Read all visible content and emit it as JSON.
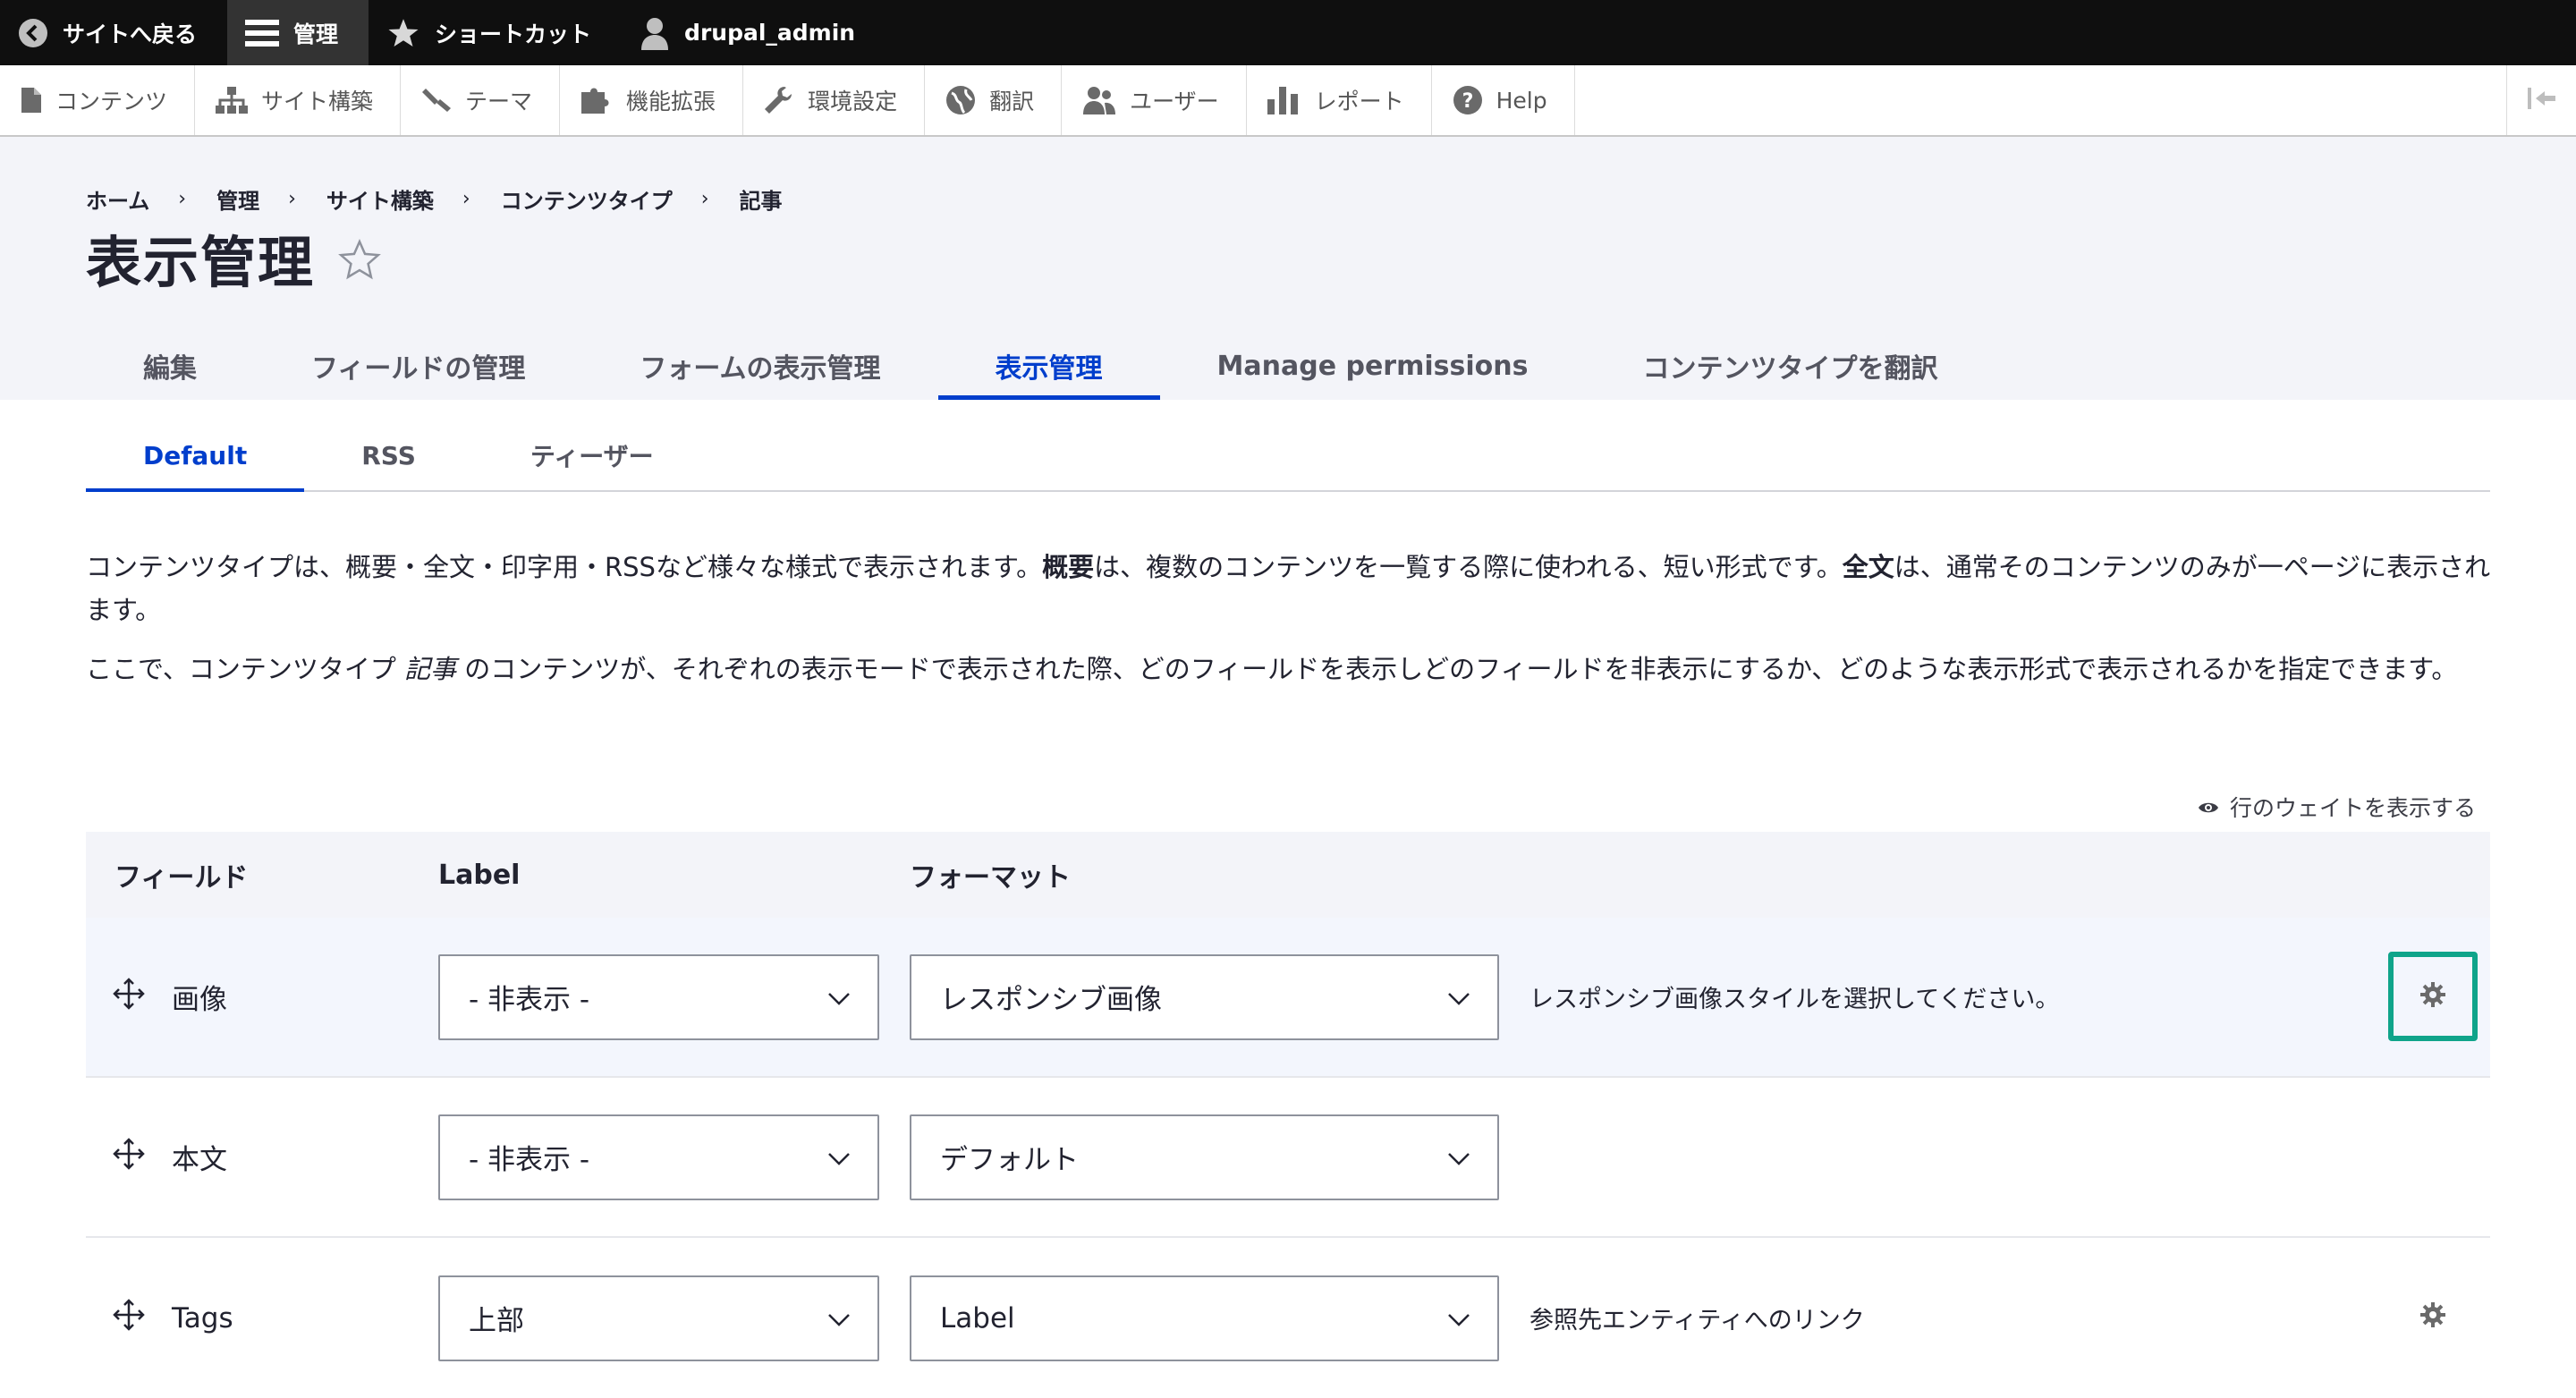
{
  "toolbar": {
    "back_label": "サイトへ戻る",
    "manage_label": "管理",
    "shortcuts_label": "ショートカット",
    "user_label": "drupal_admin"
  },
  "tray": {
    "items": [
      {
        "label": "コンテンツ",
        "icon": "file-icon"
      },
      {
        "label": "サイト構築",
        "icon": "sitemap-icon"
      },
      {
        "label": "テーマ",
        "icon": "paintbrush-icon"
      },
      {
        "label": "機能拡張",
        "icon": "puzzle-icon"
      },
      {
        "label": "環境設定",
        "icon": "wrench-icon"
      },
      {
        "label": "翻訳",
        "icon": "globe-icon"
      },
      {
        "label": "ユーザー",
        "icon": "people-icon"
      },
      {
        "label": "レポート",
        "icon": "bar-chart-icon"
      },
      {
        "label": "Help",
        "icon": "help-icon"
      }
    ]
  },
  "breadcrumb": [
    "ホーム",
    "管理",
    "サイト構築",
    "コンテンツタイプ",
    "記事"
  ],
  "breadcrumb_sep": "›",
  "page_title": "表示管理",
  "primary_tabs": [
    "編集",
    "フィールドの管理",
    "フォームの表示管理",
    "表示管理",
    "Manage permissions",
    "コンテンツタイプを翻訳"
  ],
  "secondary_tabs": [
    "Default",
    "RSS",
    "ティーザー"
  ],
  "description": {
    "p1_a": "コンテンツタイプは、概要・全文・印字用・RSSなど様々な様式で表示されます。",
    "p1_b": "概要",
    "p1_c": "は、複数のコンテンツを一覧する際に使われる、短い形式です。",
    "p1_d": "全文",
    "p1_e": "は、通常そのコンテンツのみが一ページに表示されます。",
    "p2_a": "ここで、コンテンツタイプ ",
    "p2_b": "記事",
    "p2_c": " のコンテンツが、それぞれの表示モードで表示された際、どのフィールドを表示しどのフィールドを非表示にするか、どのような表示形式で表示されるかを指定できます。"
  },
  "show_weights": "行のウェイトを表示する",
  "table": {
    "headers": [
      "フィールド",
      "Label",
      "フォーマット"
    ],
    "rows": [
      {
        "field": "画像",
        "label": "- 非表示 -",
        "format": "レスポンシブ画像",
        "summary": "レスポンシブ画像スタイルを選択してください。"
      },
      {
        "field": "本文",
        "label": "- 非表示 -",
        "format": "デフォルト",
        "summary": ""
      },
      {
        "field": "Tags",
        "label": "上部",
        "format": "Label",
        "summary": "参照先エンティティへのリンク"
      }
    ]
  },
  "colors": {
    "accent": "#003ecc",
    "focus_ring": "#0fa48a",
    "toolbar_bg": "#0f0f0f",
    "header_bg": "#f3f4f9"
  }
}
